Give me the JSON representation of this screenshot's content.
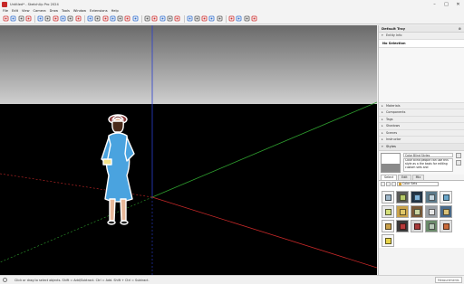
{
  "window": {
    "title": "Untitled* - SketchUp Pro 2024",
    "controls": {
      "minimize": "–",
      "maximize": "□",
      "close": "✕"
    }
  },
  "menu": [
    "File",
    "Edit",
    "View",
    "Camera",
    "Draw",
    "Tools",
    "Window",
    "Extensions",
    "Help"
  ],
  "toolbar": {
    "tools": [
      {
        "name": "search-icon"
      },
      {
        "name": "select-arrow-icon"
      },
      {
        "name": "lasso-select-icon"
      },
      {
        "name": "eraser-icon"
      },
      {
        "name": "paint-bucket-icon"
      },
      {
        "name": "line-pencil-icon"
      },
      {
        "name": "freehand-icon"
      },
      {
        "name": "rectangle-icon"
      },
      {
        "name": "circle-icon"
      },
      {
        "name": "push-pull-icon"
      },
      {
        "name": "move-icon"
      },
      {
        "name": "rotate-icon"
      },
      {
        "name": "scale-icon"
      },
      {
        "name": "offset-icon"
      },
      {
        "name": "tape-measure-icon"
      },
      {
        "name": "text-icon"
      },
      {
        "name": "axes-icon"
      },
      {
        "name": "orbit-icon"
      },
      {
        "name": "pan-icon"
      },
      {
        "name": "zoom-icon"
      },
      {
        "name": "zoom-window-icon"
      },
      {
        "name": "zoom-extents-icon"
      },
      {
        "name": "section-plane-icon"
      },
      {
        "name": "walk-icon"
      },
      {
        "name": "look-around-icon"
      },
      {
        "name": "position-camera-icon"
      },
      {
        "name": "warehouse-icon"
      },
      {
        "name": "extension-warehouse-icon"
      },
      {
        "name": "send-to-layout-icon"
      },
      {
        "name": "extension-manager-icon"
      },
      {
        "name": "components-icon"
      }
    ],
    "accent_red": "#d32f2f",
    "accent_blue": "#2f6fd3"
  },
  "tray": {
    "title": "Default Tray",
    "entity_info": {
      "label": "Entity Info",
      "value": "No Selection"
    },
    "panels": [
      "Materials",
      "Components",
      "Tags",
      "Shadows",
      "Scenes",
      "Instructor"
    ],
    "styles": {
      "label": "Styles",
      "name": "Color Blind Styles",
      "description": "Color blind people can use this style as a the basis for editing custom sets and",
      "tabs": [
        "Select",
        "Edit",
        "Mix"
      ],
      "active_tab": "Select",
      "library": "Color Sets",
      "swatches": [
        {
          "bg": "#f2f2f2",
          "cube": "#9fb7c9"
        },
        {
          "bg": "#5a5a5a",
          "cube": "#b7c96a"
        },
        {
          "bg": "#223344",
          "cube": "#7fb3d9"
        },
        {
          "bg": "#5c7a8a",
          "cube": "#c4d6e0"
        },
        {
          "bg": "#f0f0f0",
          "cube": "#6aa6c9"
        },
        {
          "bg": "#e8e8e8",
          "cube": "#d4e07a"
        },
        {
          "bg": "#c9a24a",
          "cube": "#e0c86a"
        },
        {
          "bg": "#7a5a3a",
          "cube": "#c9d4a0"
        },
        {
          "bg": "#9aa0a6",
          "cube": "#e8e8e8"
        },
        {
          "bg": "#4a6a8a",
          "cube": "#d9c27a"
        },
        {
          "bg": "#f4f4f4",
          "cube": "#c9a04a"
        },
        {
          "bg": "#3a3a3a",
          "cube": "#b83a3a"
        },
        {
          "bg": "#d9d9d9",
          "cube": "#a83a3a"
        },
        {
          "bg": "#6a8a6a",
          "cube": "#b8c9b8"
        },
        {
          "bg": "#e0e0e0",
          "cube": "#c96a3a"
        },
        {
          "bg": "#f6f6f6",
          "cube": "#e8d44a"
        }
      ]
    }
  },
  "statusbar": {
    "text": "Click or drag to select objects. Shift = Add/Subtract. Ctrl = Add. Shift + Ctrl = Subtract.",
    "measurements_label": "Measurements"
  },
  "scene": {
    "sky_color": "#9a9a9a",
    "ground_color": "#000000",
    "axis_colors": {
      "red": "#c62828",
      "green": "#2e9e2e",
      "blue": "#2b3fd0"
    }
  }
}
